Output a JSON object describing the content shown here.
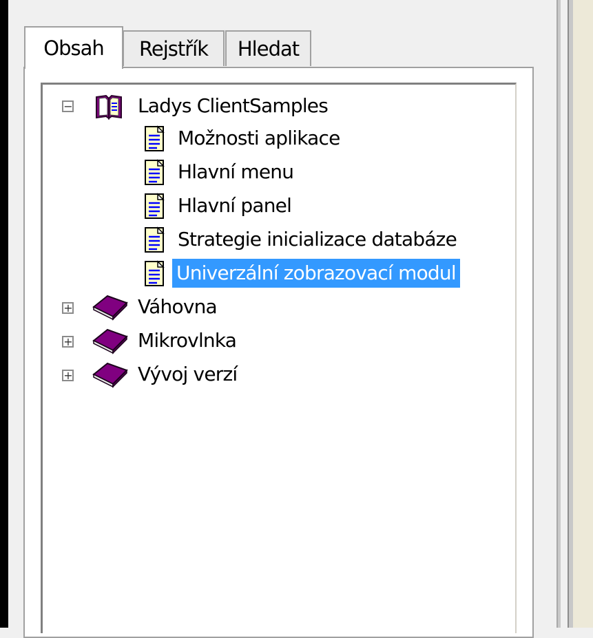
{
  "tabs": [
    {
      "label": "Obsah",
      "active": true
    },
    {
      "label": "Rejstřík",
      "active": false
    },
    {
      "label": "Hledat",
      "active": false
    }
  ],
  "tree": {
    "nodes": [
      {
        "label": "Ladys ClientSamples",
        "type": "book-open",
        "expander": "minus",
        "expanded": true
      },
      {
        "label": "Možnosti aplikace",
        "type": "page"
      },
      {
        "label": "Hlavní menu",
        "type": "page"
      },
      {
        "label": "Hlavní panel",
        "type": "page"
      },
      {
        "label": "Strategie inicializace databáze",
        "type": "page"
      },
      {
        "label": "Univerzální zobrazovací modul",
        "type": "page",
        "selected": true
      },
      {
        "label": "Váhovna",
        "type": "book-closed",
        "expander": "plus"
      },
      {
        "label": "Mikrovlnka",
        "type": "book-closed",
        "expander": "plus"
      },
      {
        "label": "Vývoj verzí",
        "type": "book-closed",
        "expander": "plus"
      }
    ]
  },
  "colors": {
    "selection": "#3399ff",
    "book": "#800080",
    "page_text_lines": "#0000ff"
  }
}
